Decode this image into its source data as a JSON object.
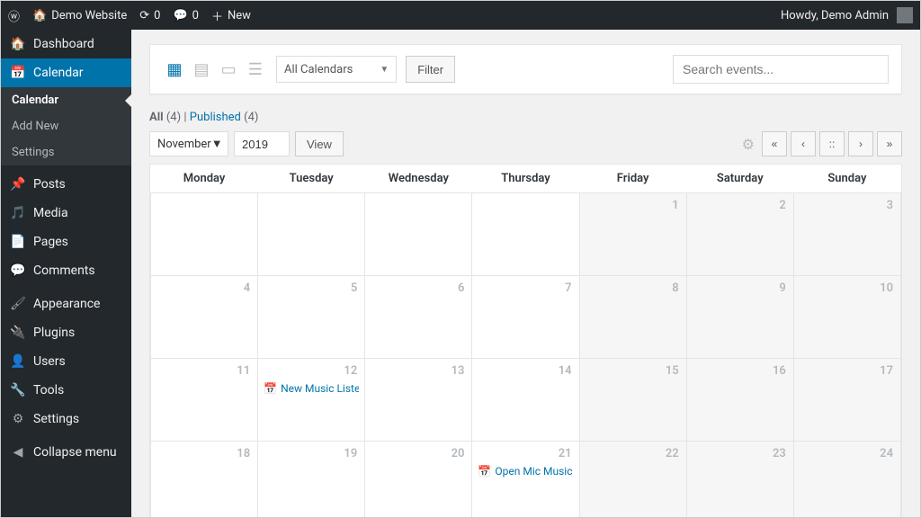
{
  "adminbar": {
    "site": "Demo Website",
    "updates": "0",
    "comments": "0",
    "new": "New",
    "howdy": "Howdy, Demo Admin"
  },
  "sidebar": {
    "dashboard": "Dashboard",
    "calendar": "Calendar",
    "sub_calendar": "Calendar",
    "sub_addnew": "Add New",
    "sub_settings": "Settings",
    "posts": "Posts",
    "media": "Media",
    "pages": "Pages",
    "comments": "Comments",
    "appearance": "Appearance",
    "plugins": "Plugins",
    "users": "Users",
    "tools": "Tools",
    "settings": "Settings",
    "collapse": "Collapse menu"
  },
  "toolbar": {
    "calendars_select": "All Calendars",
    "filter": "Filter",
    "search_placeholder": "Search events..."
  },
  "subsub": {
    "all": "All",
    "all_count": "(4)",
    "sep": " | ",
    "published": "Published",
    "published_count": "(4)"
  },
  "nav": {
    "month": "November",
    "year": "2019",
    "view": "View"
  },
  "cal": {
    "days": {
      "mon": "Monday",
      "tue": "Tuesday",
      "wed": "Wednesday",
      "thu": "Thursday",
      "fri": "Friday",
      "sat": "Saturday",
      "sun": "Sunday"
    },
    "row1": {
      "fri": "1",
      "sat": "2",
      "sun": "3"
    },
    "row2": {
      "mon": "4",
      "tue": "5",
      "wed": "6",
      "thu": "7",
      "fri": "8",
      "sat": "9",
      "sun": "10"
    },
    "row3": {
      "mon": "11",
      "tue": "12",
      "wed": "13",
      "thu": "14",
      "fri": "15",
      "sat": "16",
      "sun": "17"
    },
    "row4": {
      "mon": "18",
      "tue": "19",
      "wed": "20",
      "thu": "21",
      "fri": "22",
      "sat": "23",
      "sun": "24"
    }
  },
  "events": {
    "e1": "New Music Listeni...",
    "e2": "Open Mic Music ..."
  }
}
